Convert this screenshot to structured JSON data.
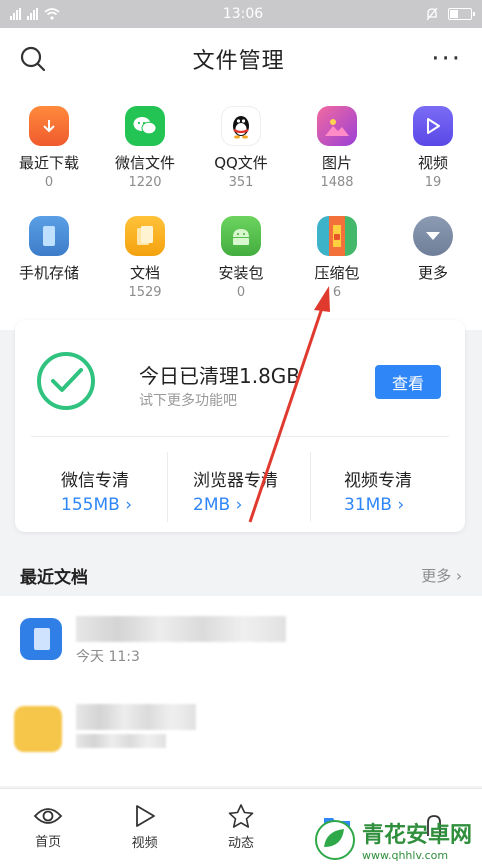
{
  "status": {
    "time": "13:06"
  },
  "header": {
    "title": "文件管理",
    "more": "···"
  },
  "categories": [
    {
      "label": "最近下载",
      "count": "0",
      "icon": "download-icon",
      "color": "#f26b36"
    },
    {
      "label": "微信文件",
      "count": "1220",
      "icon": "wechat-icon",
      "color": "#23c453"
    },
    {
      "label": "QQ文件",
      "count": "351",
      "icon": "qq-icon",
      "color": "#ffffff"
    },
    {
      "label": "图片",
      "count": "1488",
      "icon": "image-icon",
      "color": "#c84ccd"
    },
    {
      "label": "视频",
      "count": "19",
      "icon": "video-play-icon",
      "color": "#6b5cf0"
    },
    {
      "label": "手机存储",
      "count": "",
      "icon": "phone-storage-icon",
      "color": "#4a8bd8"
    },
    {
      "label": "文档",
      "count": "1529",
      "icon": "document-icon",
      "color": "#f5b21c"
    },
    {
      "label": "安装包",
      "count": "0",
      "icon": "android-icon",
      "color": "#57c24f"
    },
    {
      "label": "压缩包",
      "count": "6",
      "icon": "archive-icon",
      "color": "#ef7a3a"
    },
    {
      "label": "更多",
      "count": "",
      "icon": "chevron-down-icon",
      "color": "#7f8fa9"
    }
  ],
  "cleanup": {
    "title": "今日已清理1.8GB",
    "subtitle": "试下更多功能吧",
    "button": "查看",
    "items": [
      {
        "name": "微信专清",
        "size": "155MB"
      },
      {
        "name": "浏览器专清",
        "size": "2MB"
      },
      {
        "name": "视频专清",
        "size": "31MB"
      }
    ]
  },
  "recent": {
    "title": "最近文档",
    "more": "更多",
    "items": [
      {
        "time": "今天 11:3"
      },
      {
        "time": ""
      }
    ]
  },
  "nav": [
    {
      "label": "首页",
      "icon": "eye-home-icon"
    },
    {
      "label": "视频",
      "icon": "play-icon"
    },
    {
      "label": "动态",
      "icon": "star-icon"
    },
    {
      "label": "",
      "icon": "folder-icon"
    },
    {
      "label": "",
      "icon": "profile-icon"
    }
  ],
  "watermark": {
    "name": "青花安卓网",
    "url": "www.qhhlv.com"
  }
}
